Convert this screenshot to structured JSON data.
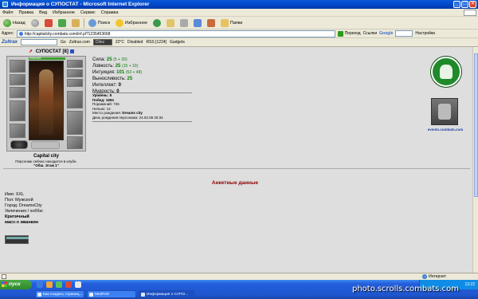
{
  "window": {
    "title": "Информация о СУПОСТАТ - Microsoft Internet Explorer",
    "buttons": [
      "_",
      "□",
      "×"
    ]
  },
  "menu": [
    "Файл",
    "Правка",
    "Вид",
    "Избранное",
    "Сервис",
    "Справка"
  ],
  "toolbar": {
    "back_label": "Назад",
    "search_label": "Поиск",
    "favorites_label": "Избранное",
    "folders_label": "Папки"
  },
  "address": {
    "label": "Адрес:",
    "url": "http://capitalcity.combats.com/inf.pl?1235453668",
    "go_label": "Переход",
    "links_label": "Ссылки",
    "google_label": "Google",
    "settings_label": "Настройки"
  },
  "zbar": {
    "logo": "Zultrax",
    "go_label": "Go",
    "site": "Zultrax.com",
    "city_field": "Citez",
    "temp": "22°C",
    "disabled": "Disabled",
    "rss": "RSS [1224]",
    "gadgets": "Gadgets"
  },
  "character": {
    "name": "СУПОСТАТ",
    "level": "[8]",
    "hp": "255/255",
    "city": "Capital city",
    "club_note": "Персонаж сейчас находится в клубе.",
    "club_name": "\"Обш. Этаж 1\""
  },
  "stats": [
    {
      "label": "Сила:",
      "value": "25",
      "bonus": "(5 + 20)"
    },
    {
      "label": "Ловкость:",
      "value": "25",
      "bonus": "(15 + 10)"
    },
    {
      "label": "Интуиция:",
      "value": "101",
      "bonus": "(53 + 48)"
    },
    {
      "label": "Выносливость:",
      "value": "25",
      "bonus": ""
    },
    {
      "label": "Интеллект:",
      "value": "0",
      "bonus": ""
    },
    {
      "label": "Мудрость:",
      "value": "0",
      "bonus": ""
    }
  ],
  "meta": {
    "level": "Уровень: 8",
    "wins": "Побед: 1694",
    "losses": "Поражений: 726",
    "draws": "Ничьих: 14",
    "birthplace_label": "Место рождения:",
    "birthplace": "Dreams city",
    "birthday": "День рождения персонажа: 24.02.09 20:34"
  },
  "events_label": "events.combats.com",
  "profile": {
    "section_title": "Анкетные данные",
    "name": "Имя: XXL",
    "gender": "Пол: Мужской",
    "city": "Город: DreamsCity",
    "hobby_label": "Увлечения / хобби:",
    "hobby_1": "Критичный",
    "hobby_2": "масс-х иванкин"
  },
  "status": {
    "zone": "Интернет"
  },
  "taskbar": {
    "start": "пуск",
    "tasks": [
      "Как создать страниц...",
      "MedFed",
      "Информация о СУПО..."
    ],
    "lang": "RU",
    "clock": "13:22"
  },
  "watermark": "photo.scrolls.combats.com"
}
